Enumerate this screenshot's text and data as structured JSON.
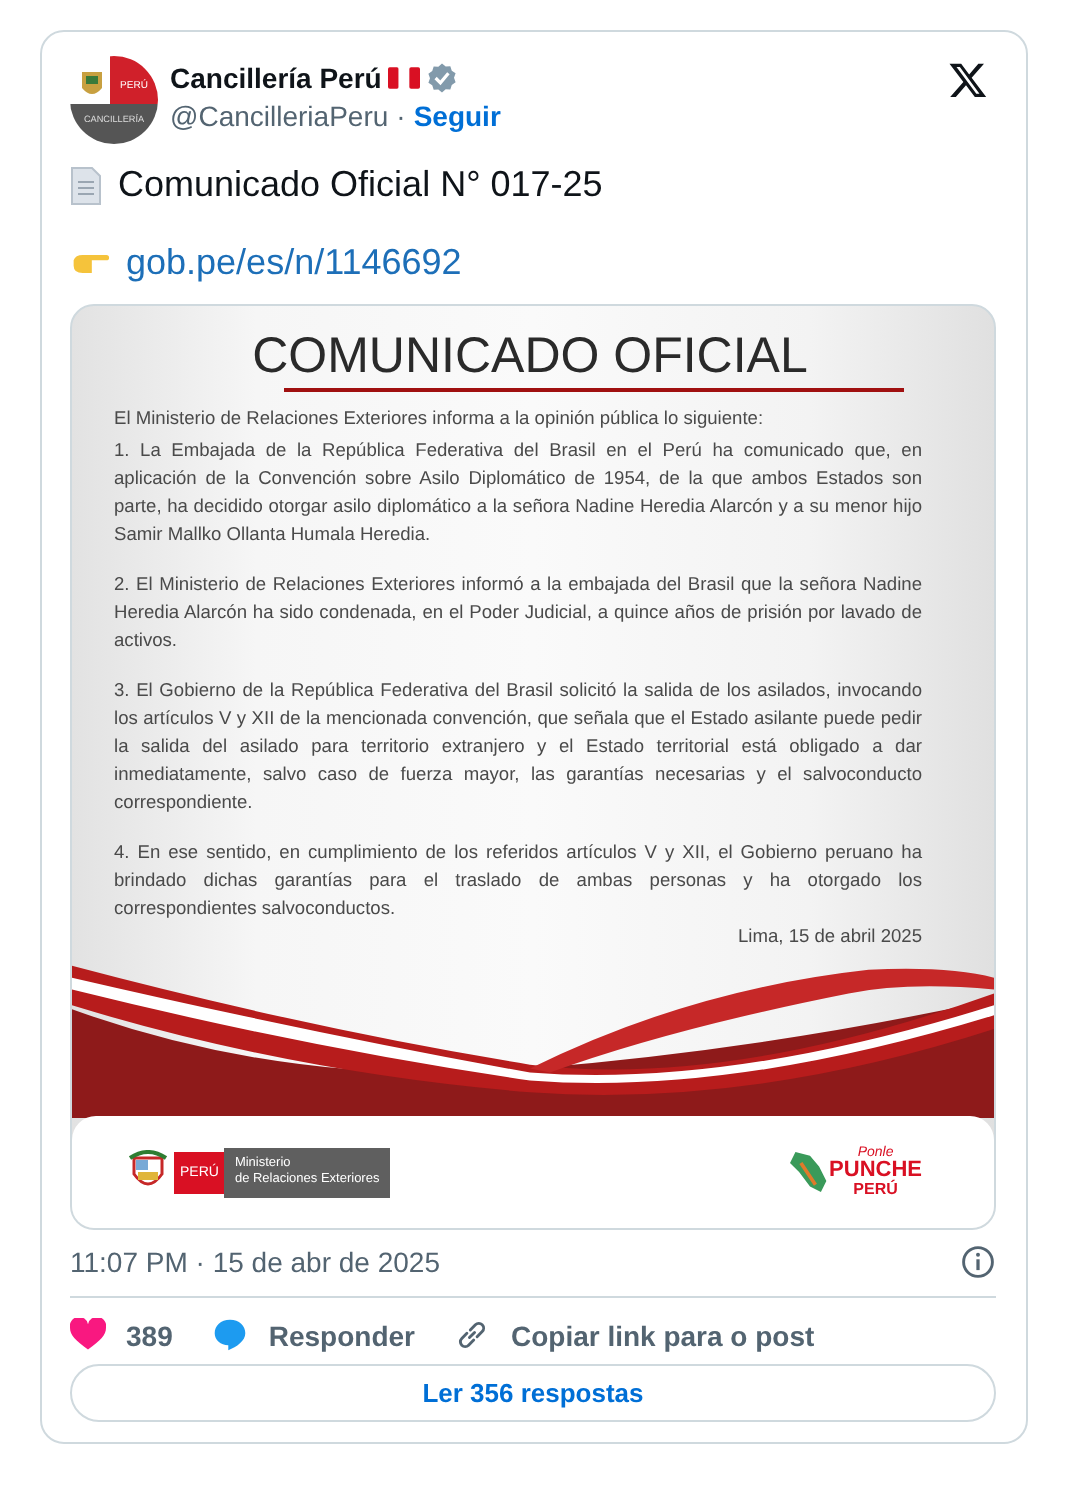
{
  "post": {
    "avatar": {
      "top_label": "PERÚ",
      "bottom_label": "CANCILLERÍA"
    },
    "author": {
      "name": "Cancillería Perú",
      "handle": "@CancilleriaPeru",
      "separator": "·",
      "follow": "Seguir"
    },
    "text": "Comunicado Oficial N° 017-25",
    "link": "gob.pe/es/n/1146692",
    "document": {
      "title": "COMUNICADO OFICIAL",
      "intro": "El Ministerio de Relaciones Exteriores informa a la opinión pública lo siguiente:",
      "paragraphs": [
        "1.  La Embajada de la República Federativa del Brasil en el Perú ha comunicado que, en aplicación de la Convención sobre Asilo Diplomático de 1954, de la que ambos Estados son parte, ha decidido otorgar asilo diplomático a la señora Nadine Heredia Alarcón y a su menor hijo Samir Mallko Ollanta Humala Heredia.",
        "2. El Ministerio de Relaciones Exteriores informó a la embajada del Brasil que la señora Nadine Heredia Alarcón ha sido condenada, en el Poder Judicial, a quince años de prisión por lavado de activos.",
        "3. El Gobierno de la República Federativa del Brasil solicitó la salida de los asilados, invocando los artículos V y XII de la mencionada convención, que señala que el Estado asilante puede pedir la salida del asilado para territorio extranjero y el Estado territorial está obligado a dar inmediatamente, salvo caso de fuerza mayor, las garantías necesarias y el salvoconducto correspondiente.",
        "4. En ese sentido, en cumplimiento de los referidos artículos V y XII, el Gobierno peruano ha brindado dichas garantías para el traslado de ambas personas y ha otorgado los correspondientes salvoconductos."
      ],
      "place_date": "Lima, 15 de abril 2025",
      "footer": {
        "country": "PERÚ",
        "ministry": [
          "Ministerio",
          "de Relaciones Exteriores"
        ],
        "campaign": [
          "Ponle",
          "PUNCHE",
          "PERÚ"
        ]
      }
    },
    "timestamp": "11:07 PM · 15 de abr de 2025",
    "likes": "389",
    "actions": [
      {
        "kind": "reply",
        "label": "Responder"
      },
      {
        "kind": "copy_link",
        "label": "Copiar link para o post"
      }
    ],
    "read_replies": "Ler 356 respostas"
  }
}
